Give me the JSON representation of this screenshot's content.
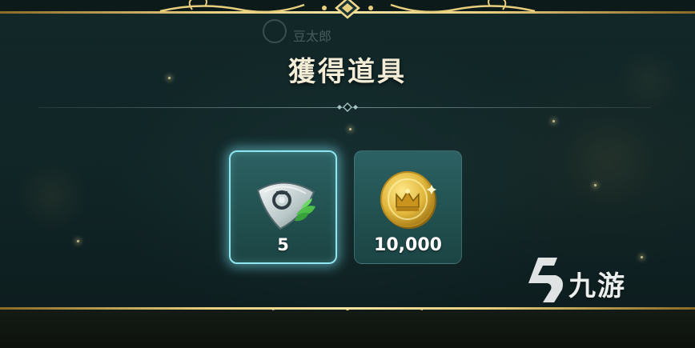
{
  "dialog": {
    "background_name": "豆太郎",
    "title": "獲得道具"
  },
  "items": [
    {
      "icon": "green-shield-leaf-icon",
      "count": "5",
      "selected": true
    },
    {
      "icon": "gold-crown-coin-icon",
      "count": "10,000",
      "selected": false
    }
  ],
  "watermark": {
    "text": "九游"
  },
  "colors": {
    "gold_trim": "#e8cf7e",
    "panel": "#1e4646",
    "item_bg": "#2c6163",
    "selected_glow": "#8fe6f0",
    "title_text": "#f3ecd6"
  }
}
